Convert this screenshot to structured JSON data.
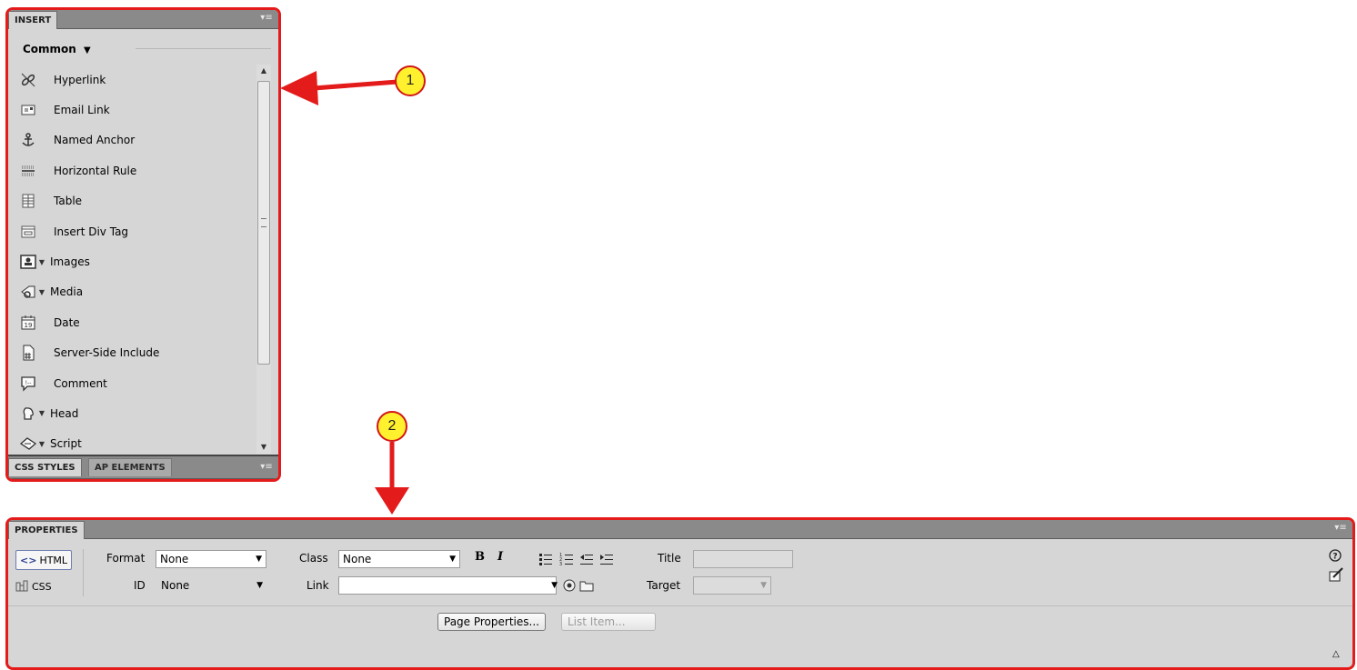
{
  "insert_panel": {
    "tab_label": "INSERT",
    "category": "Common",
    "items": [
      {
        "label": "Hyperlink",
        "icon": "hyperlink-icon",
        "dropdown": false
      },
      {
        "label": "Email Link",
        "icon": "email-link-icon",
        "dropdown": false
      },
      {
        "label": "Named Anchor",
        "icon": "anchor-icon",
        "dropdown": false
      },
      {
        "label": "Horizontal Rule",
        "icon": "horizontal-rule-icon",
        "dropdown": false
      },
      {
        "label": "Table",
        "icon": "table-icon",
        "dropdown": false
      },
      {
        "label": "Insert Div Tag",
        "icon": "div-tag-icon",
        "dropdown": false
      },
      {
        "label": "Images",
        "icon": "images-icon",
        "dropdown": true
      },
      {
        "label": "Media",
        "icon": "media-icon",
        "dropdown": true
      },
      {
        "label": "Date",
        "icon": "date-icon",
        "dropdown": false
      },
      {
        "label": "Server-Side Include",
        "icon": "server-side-include-icon",
        "dropdown": false
      },
      {
        "label": "Comment",
        "icon": "comment-icon",
        "dropdown": false
      },
      {
        "label": "Head",
        "icon": "head-icon",
        "dropdown": true
      },
      {
        "label": "Script",
        "icon": "script-icon",
        "dropdown": true
      }
    ],
    "bottom_tabs": [
      "CSS STYLES",
      "AP ELEMENTS"
    ]
  },
  "callouts": {
    "one": "1",
    "two": "2"
  },
  "properties_panel": {
    "tab_label": "PROPERTIES",
    "html_mode_label": "HTML",
    "css_mode_label": "CSS",
    "format_label": "Format",
    "format_value": "None",
    "id_label": "ID",
    "id_value": "None",
    "class_label": "Class",
    "class_value": "None",
    "link_label": "Link",
    "link_value": "",
    "bold_label": "B",
    "italic_label": "I",
    "title_label": "Title",
    "title_value": "",
    "target_label": "Target",
    "target_value": "",
    "page_properties_label": "Page Properties...",
    "list_item_label": "List Item..."
  },
  "colors": {
    "callout_fill": "#fff12e",
    "callout_border": "#d31717",
    "highlight_border": "#e41b1b"
  }
}
